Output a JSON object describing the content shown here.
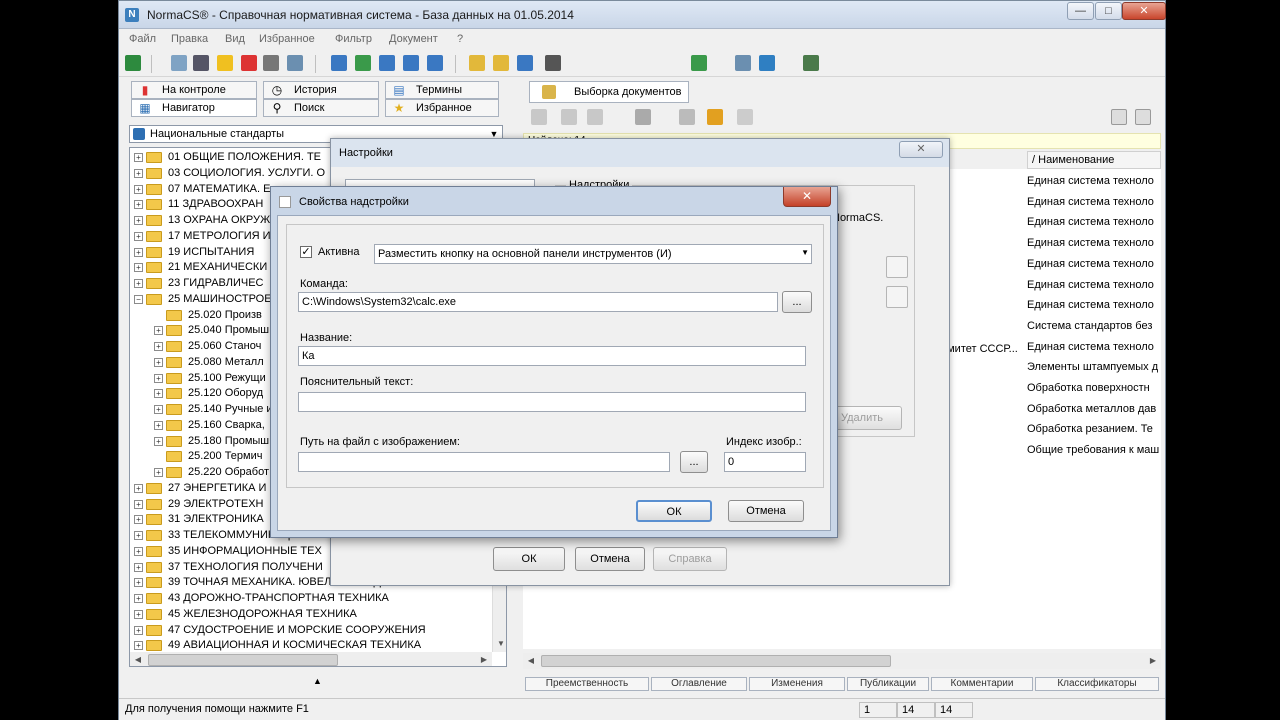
{
  "window": {
    "title": "NormaCS® - Справочная нормативная система - База данных на 01.05.2014",
    "minimize": "—",
    "maximize": "□",
    "close": "✕"
  },
  "menu": [
    "Файл",
    "Правка",
    "Вид",
    "Избранное",
    "Фильтр",
    "Документ",
    "?"
  ],
  "left_tabs": {
    "row1": [
      "На контроле",
      "История",
      "Термины"
    ],
    "row2": [
      "Навигатор",
      "Поиск",
      "Избранное"
    ]
  },
  "combo": {
    "value": "Национальные стандарты"
  },
  "tree": [
    {
      "label": "01  ОБЩИЕ ПОЛОЖЕНИЯ. ТЕ",
      "level": 0,
      "exp": "+"
    },
    {
      "label": "03  СОЦИОЛОГИЯ. УСЛУГИ. О",
      "level": 0,
      "exp": "+"
    },
    {
      "label": "07  МАТЕМАТИКА. Е",
      "level": 0,
      "exp": "+"
    },
    {
      "label": "11  ЗДРАВООХРАН",
      "level": 0,
      "exp": "+"
    },
    {
      "label": "13  ОХРАНА ОКРУЖ",
      "level": 0,
      "exp": "+"
    },
    {
      "label": "17  МЕТРОЛОГИЯ И",
      "level": 0,
      "exp": "+"
    },
    {
      "label": "19  ИСПЫТАНИЯ",
      "level": 0,
      "exp": "+"
    },
    {
      "label": "21  МЕХАНИЧЕСКИ",
      "level": 0,
      "exp": "+"
    },
    {
      "label": "23  ГИДРАВЛИЧЕС",
      "level": 0,
      "exp": "+"
    },
    {
      "label": "25  МАШИНОСТРОЕ",
      "level": 0,
      "exp": "−"
    },
    {
      "label": "25.020  Произв",
      "level": 1,
      "exp": ""
    },
    {
      "label": "25.040  Промыш",
      "level": 1,
      "exp": "+"
    },
    {
      "label": "25.060  Станоч",
      "level": 1,
      "exp": "+"
    },
    {
      "label": "25.080  Металл",
      "level": 1,
      "exp": "+"
    },
    {
      "label": "25.100  Режущи",
      "level": 1,
      "exp": "+"
    },
    {
      "label": "25.120  Оборуд",
      "level": 1,
      "exp": "+"
    },
    {
      "label": "25.140  Ручные и",
      "level": 1,
      "exp": "+"
    },
    {
      "label": "25.160  Сварка,",
      "level": 1,
      "exp": "+"
    },
    {
      "label": "25.180  Промыш",
      "level": 1,
      "exp": "+"
    },
    {
      "label": "25.200  Термич",
      "level": 1,
      "exp": ""
    },
    {
      "label": "25.220  Обработ",
      "level": 1,
      "exp": "+"
    },
    {
      "label": "27  ЭНЕРГЕТИКА И",
      "level": 0,
      "exp": "+"
    },
    {
      "label": "29  ЭЛЕКТРОТЕХН",
      "level": 0,
      "exp": "+"
    },
    {
      "label": "31  ЭЛЕКТРОНИКА",
      "level": 0,
      "exp": "+"
    },
    {
      "label": "33  ТЕЛЕКОММУНИКАЦИИ. АУ",
      "level": 0,
      "exp": "+"
    },
    {
      "label": "35  ИНФОРМАЦИОННЫЕ ТЕХ",
      "level": 0,
      "exp": "+"
    },
    {
      "label": "37  ТЕХНОЛОГИЯ ПОЛУЧЕНИ",
      "level": 0,
      "exp": "+"
    },
    {
      "label": "39  ТОЧНАЯ МЕХАНИКА. ЮВЕЛИРНОЕ ДЕЛО",
      "level": 0,
      "exp": "+"
    },
    {
      "label": "43  ДОРОЖНО-ТРАНСПОРТНАЯ ТЕХНИКА",
      "level": 0,
      "exp": "+"
    },
    {
      "label": "45  ЖЕЛЕЗНОДОРОЖНАЯ ТЕХНИКА",
      "level": 0,
      "exp": "+"
    },
    {
      "label": "47  СУДОСТРОЕНИЕ И МОРСКИЕ СООРУЖЕНИЯ",
      "level": 0,
      "exp": "+"
    },
    {
      "label": "49  АВИАЦИОННАЯ И КОСМИЧЕСКАЯ ТЕХНИКА",
      "level": 0,
      "exp": "+"
    }
  ],
  "right": {
    "tab": "Выборка документов",
    "found": "Найдено: 14",
    "column": "Наименование",
    "rows": [
      "Единая система техноло",
      "Единая система техноло",
      "Единая система техноло",
      "Единая система техноло",
      "Единая система техноло",
      "Единая система техноло",
      "Единая система техноло",
      "Система стандартов без",
      "Единая система техноло",
      "Элементы штампуемых д",
      "Обработка поверхностн",
      "Обработка металлов дав",
      "Обработка резанием. Те",
      "Общие требования к маш"
    ],
    "partial_cell": "омитет СССР...",
    "bottom_tabs": [
      "Преемственность",
      "Оглавление",
      "Изменения",
      "Публикации",
      "Комментарии",
      "Классификаторы"
    ]
  },
  "statusbar": {
    "help": "Для получения помощи нажмите F1",
    "p1": "1",
    "p2": "14",
    "p3": "14"
  },
  "settings": {
    "title": "Настройки",
    "group_label": "Надстройки",
    "side_text": "NormaCS.",
    "delete_label": "Удалить",
    "ok": "ОК",
    "cancel": "Отмена",
    "help": "Справка"
  },
  "props": {
    "title": "Свойства надстройки",
    "active_label": "Активна",
    "active_checked": true,
    "placement": "Разместить кнопку на основной панели инструментов (И)",
    "command_label": "Команда:",
    "command_value": "C:\\Windows\\System32\\calc.exe",
    "browse": "...",
    "name_label": "Название:",
    "name_value": "Ка",
    "desc_label": "Пояснительный текст:",
    "desc_value": "",
    "image_label": "Путь на файл с изображением:",
    "image_value": "",
    "index_label": "Индекс изобр.:",
    "index_value": "0",
    "ok": "ОК",
    "cancel": "Отмена"
  }
}
